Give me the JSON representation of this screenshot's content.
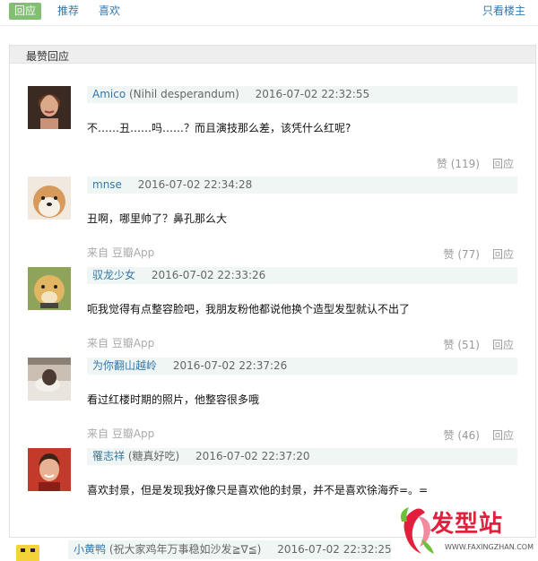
{
  "tabs": [
    {
      "label": "回应",
      "active": true
    },
    {
      "label": "推荐",
      "active": false
    },
    {
      "label": "喜欢",
      "active": false
    }
  ],
  "only_op": "只看楼主",
  "section_title": "最赞回应",
  "comments": [
    {
      "author": "Amico",
      "note": "(Nihil desperandum)",
      "time": "2016-07-02 22:32:55",
      "text": "不……丑……吗……？而且演技那么差，该凭什么红呢?",
      "source": "",
      "likes": "赞 (119)",
      "reply": "回应"
    },
    {
      "author": "mnse",
      "note": "",
      "time": "2016-07-02 22:34:28",
      "text": "丑啊，哪里帅了？鼻孔那么大",
      "source": "来自 豆瓣App",
      "likes": "赞 (77)",
      "reply": "回应"
    },
    {
      "author": "驭龙少女",
      "note": "",
      "time": "2016-07-02 22:33:26",
      "text": "呃我觉得有点整容脸吧，我朋友粉他都说他换个造型发型就认不出了",
      "source": "来自 豆瓣App",
      "likes": "赞 (51)",
      "reply": "回应"
    },
    {
      "author": "为你翻山越岭",
      "note": "",
      "time": "2016-07-02 22:37:26",
      "text": "看过红楼时期的照片，他整容很多哦",
      "source": "来自 豆瓣App",
      "likes": "赞 (46)",
      "reply": "回应"
    },
    {
      "author": "罹志祥",
      "note": "(糖真好吃)",
      "time": "2016-07-02 22:37:20",
      "text": "喜欢封景，但是发现我好像只是喜欢他的封景，并不是喜欢徐海乔=。=",
      "source": "",
      "likes": "",
      "reply": ""
    }
  ],
  "last_comment": {
    "author": "小黄鸭",
    "note": "(祝大家鸡年万事稳如沙发≧∇≦)",
    "time": "2016-07-02 22:32:25"
  },
  "watermark": {
    "text": "发型站",
    "url": "WWW.FAXINGZHAN.COM"
  },
  "colors": {
    "accent": "#83bf73",
    "link": "#3377aa",
    "meta_bg": "#f0f6f3",
    "brand": "#e2203d"
  }
}
